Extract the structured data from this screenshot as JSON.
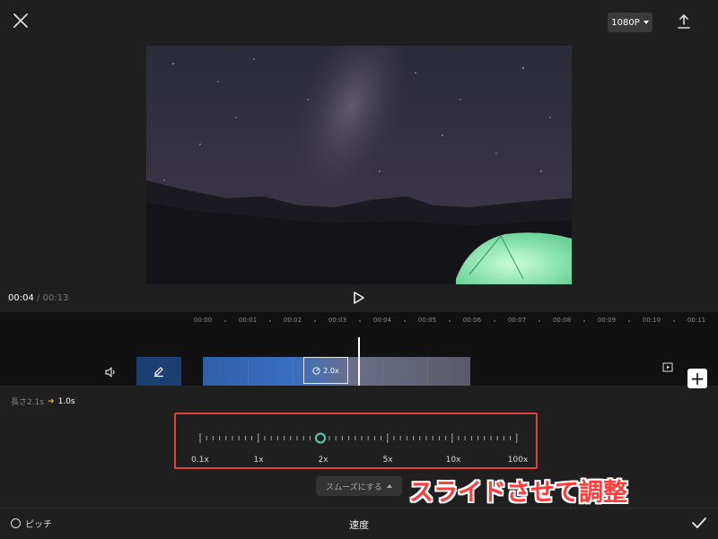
{
  "header": {
    "resolution": "1080P",
    "close_icon": "close-icon",
    "export_icon": "export-icon"
  },
  "playback": {
    "current_time": "00:04",
    "separator": "/",
    "duration": "00:13"
  },
  "timeline": {
    "ticks": [
      "00:00",
      "00:01",
      "00:02",
      "00:03",
      "00:04",
      "00:05",
      "00:06",
      "00:07",
      "00:08",
      "00:09",
      "00:10",
      "00:11"
    ],
    "clip_speed": "2.0x"
  },
  "speed_panel": {
    "length_label": "長さ2.1s",
    "new_length": "1.0s",
    "slider_labels": [
      "0.1x",
      "1x",
      "2x",
      "5x",
      "10x",
      "100x"
    ],
    "slider_value": "2x",
    "smooth_label": "スムーズにする",
    "annotation": "スライドさせて調整"
  },
  "footer": {
    "pitch_label": "ピッチ",
    "title": "速度"
  },
  "colors": {
    "highlight": "#e0403a",
    "slider_knob": "#4fd1b5",
    "annotation_text": "#ff3c3c",
    "clip_blue": "#1c3f72"
  }
}
